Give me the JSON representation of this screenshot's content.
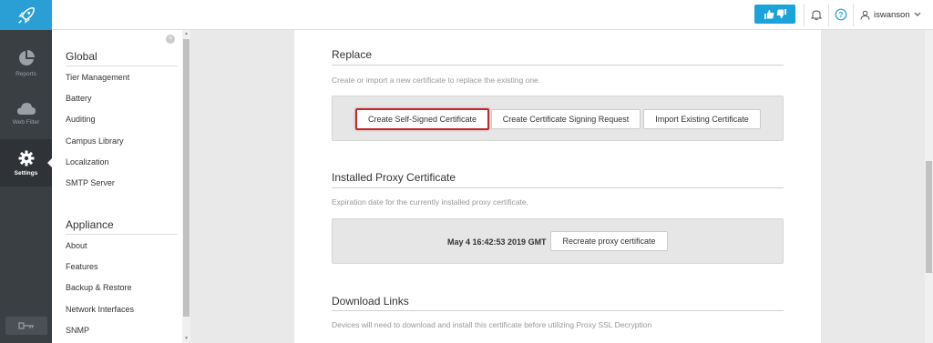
{
  "topbar": {
    "username": "iswanson"
  },
  "rail": {
    "items": [
      {
        "label": "Reports",
        "icon": "pie-chart-icon"
      },
      {
        "label": "Web Filter",
        "icon": "cloud-icon"
      },
      {
        "label": "Settings",
        "icon": "gear-icon"
      }
    ]
  },
  "nav": {
    "global_heading": "Global",
    "global_items": [
      "Tier Management",
      "Battery",
      "Auditing",
      "Campus Library",
      "Localization",
      "SMTP Server"
    ],
    "appliance_heading": "Appliance",
    "appliance_items": [
      "About",
      "Features",
      "Backup & Restore",
      "Network Interfaces",
      "SNMP"
    ]
  },
  "replace": {
    "title": "Replace",
    "description": "Create or import a new certificate to replace the existing one.",
    "buttons": [
      "Create Self-Signed Certificate",
      "Create Certificate Signing Request",
      "Import Existing Certificate"
    ]
  },
  "installed": {
    "title": "Installed Proxy Certificate",
    "description": "Expiration date for the currently installed proxy certificate.",
    "expiry": "May 4 16:42:53 2019 GMT",
    "recreate_label": "Recreate proxy certificate"
  },
  "download": {
    "title": "Download Links",
    "description": "Devices will need to download and install this certificate before utilizing Proxy SSL Decryption"
  },
  "colors": {
    "brand": "#2a9fd6",
    "highlight": "#c0282d",
    "rail_bg": "#3a3f44"
  }
}
